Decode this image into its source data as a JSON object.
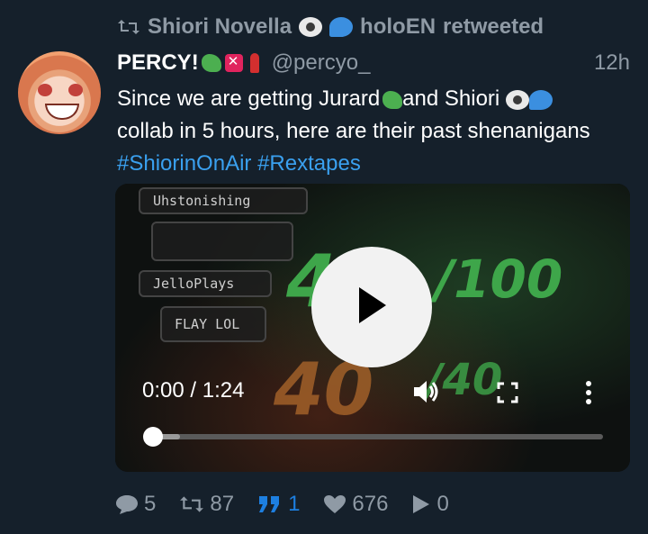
{
  "retweet_line": {
    "user": "Shiori Novella",
    "account": "holoEN",
    "suffix": "retweeted"
  },
  "tweet": {
    "display_name": "PERCY!",
    "handle": "@percyo_",
    "time": "12h",
    "text_line1": "Since we are getting Jurard",
    "text_line1_b": "and Shiori",
    "text_line2": "collab in 5 hours, here are their past shenanigans",
    "hashtags": [
      "#ShiorinOnAir",
      "#Rextapes"
    ]
  },
  "video": {
    "chat": [
      {
        "user": "Uhstonishing",
        "message": ""
      },
      {
        "user": "JelloPlays",
        "message": "FLAY LOL"
      }
    ],
    "score_top": "46",
    "score_top_max": "/100",
    "score_bottom": "40",
    "score_bottom_max": "/40",
    "current_time": "0:00",
    "separator": "/",
    "duration": "1:24",
    "progress": 0
  },
  "actions": {
    "replies": "5",
    "retweets": "87",
    "quotes": "1",
    "likes": "676",
    "views": "0"
  },
  "colors": {
    "background": "#15202b",
    "muted": "#8f9aa5",
    "link": "#3aa0ef",
    "quote_accent": "#1d7fe0"
  },
  "icons": [
    "retweet-icon",
    "eye-emoji-icon",
    "speech-bubble-emoji-icon",
    "dino-emoji-icon",
    "anger-emoji-icon",
    "lipstick-emoji-icon",
    "play-icon",
    "volume-icon",
    "fullscreen-icon",
    "more-icon",
    "reply-icon",
    "quote-icon",
    "heart-icon",
    "views-icon"
  ]
}
